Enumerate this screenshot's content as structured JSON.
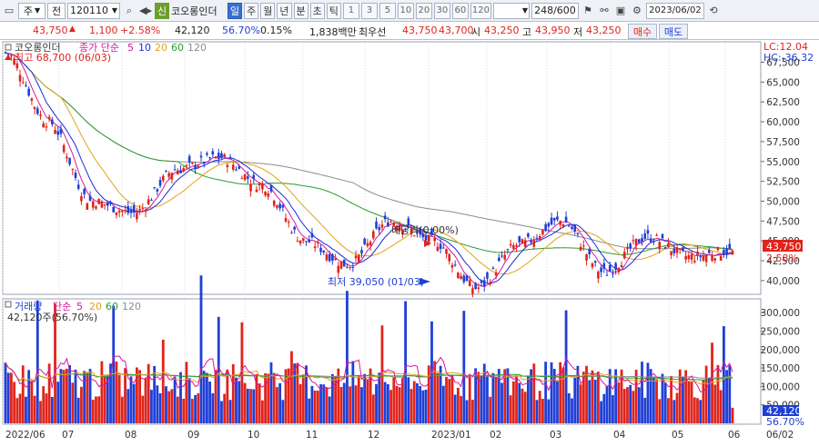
{
  "toolbar": {
    "market": "주",
    "board": "전",
    "code": "120110",
    "badge": "신",
    "stock_name": "코오롱인더",
    "periods": [
      "일",
      "주",
      "월",
      "년",
      "분",
      "초",
      "틱"
    ],
    "active_period": "일",
    "minute_options": [
      "1",
      "3",
      "5",
      "10",
      "20",
      "30",
      "60",
      "120"
    ],
    "count": "248/600",
    "date": "2023/06/02"
  },
  "quote": {
    "price": "43,750",
    "direction_icon": "up-triangle",
    "change": "1,100",
    "change_pct": "+2.58%",
    "volume": "42,120",
    "volume_ratio": "56.70%",
    "turnover": "0.15%",
    "value": "1,838백만",
    "bid_label": "최우선",
    "ask_price": "43,750",
    "bid_price": "43,700",
    "open_label": "시",
    "open": "43,250",
    "high_label": "고",
    "high": "43,950",
    "low_label": "저",
    "low": "43,250",
    "buy_label": "매수",
    "sell_label": "매도"
  },
  "price_panel": {
    "name": "코오롱인더",
    "legend_prefix": "종가 단순",
    "ma_labels": [
      "5",
      "10",
      "20",
      "60",
      "120"
    ],
    "max_label": "최고 68,700 (06/03)",
    "min_label": "최저 39,050 (01/03)",
    "dividend_label": "배당락(0.00%)",
    "lc_label": "LC:12.04",
    "hc_label": "HC:-36.32",
    "current_price_tag": "43,750",
    "current_pct_tag": "2.58%",
    "y_ticks": [
      "67,500",
      "65,000",
      "62,500",
      "60,000",
      "57,500",
      "55,000",
      "52,500",
      "50,000",
      "47,500",
      "45,000",
      "42,500",
      "40,000"
    ]
  },
  "volume_panel": {
    "title": "거래량",
    "legend_prefix": "단순",
    "ma_labels": [
      "5",
      "20",
      "60",
      "120"
    ],
    "current_label": "42,120주(56.70%)",
    "current_tag": "42,120",
    "current_pct_tag": "56.70%",
    "y_ticks": [
      "300,000",
      "250,000",
      "200,000",
      "150,000",
      "100,000",
      "50,000"
    ]
  },
  "x_axis": [
    "2022/06",
    "07",
    "08",
    "09",
    "10",
    "11",
    "12",
    "2023/01",
    "02",
    "03",
    "04",
    "05",
    "06",
    "06/02"
  ],
  "colors": {
    "up": "#e0241b",
    "down": "#1f3fd6",
    "ma5": "#d6189e",
    "ma10": "#1a2bdc",
    "ma20": "#e3a21a",
    "ma60": "#2e9a2e",
    "ma120": "#8c8c8c"
  },
  "chart_data": {
    "type": "candlestick",
    "keypoints": [
      {
        "x": "2022/06/03",
        "close": 68700
      },
      {
        "x": "2022/06 mid",
        "close": 60000
      },
      {
        "x": "2022/06 end",
        "close": 50000
      },
      {
        "x": "2022/07 mid",
        "close": 48500
      },
      {
        "x": "2022/08 early",
        "close": 54000
      },
      {
        "x": "2022/08 mid",
        "close": 55500
      },
      {
        "x": "2022/09 early",
        "close": 52000
      },
      {
        "x": "2022/09 end",
        "close": 45000
      },
      {
        "x": "2022/10 mid",
        "close": 42000
      },
      {
        "x": "2022/11 mid",
        "close": 47500
      },
      {
        "x": "2022/12 mid",
        "close": 45000
      },
      {
        "x": "2023/01/03",
        "close": 39050
      },
      {
        "x": "2023/01 end",
        "close": 44500
      },
      {
        "x": "2023/02 end",
        "close": 47500
      },
      {
        "x": "2023/03 mid",
        "close": 41000
      },
      {
        "x": "2023/04 mid",
        "close": 45500
      },
      {
        "x": "2023/05 mid",
        "close": 43000
      },
      {
        "x": "2023/06/02",
        "close": 43750
      }
    ],
    "price_ylim": [
      38500,
      68700
    ],
    "volume_ylim": [
      0,
      330000
    ]
  }
}
